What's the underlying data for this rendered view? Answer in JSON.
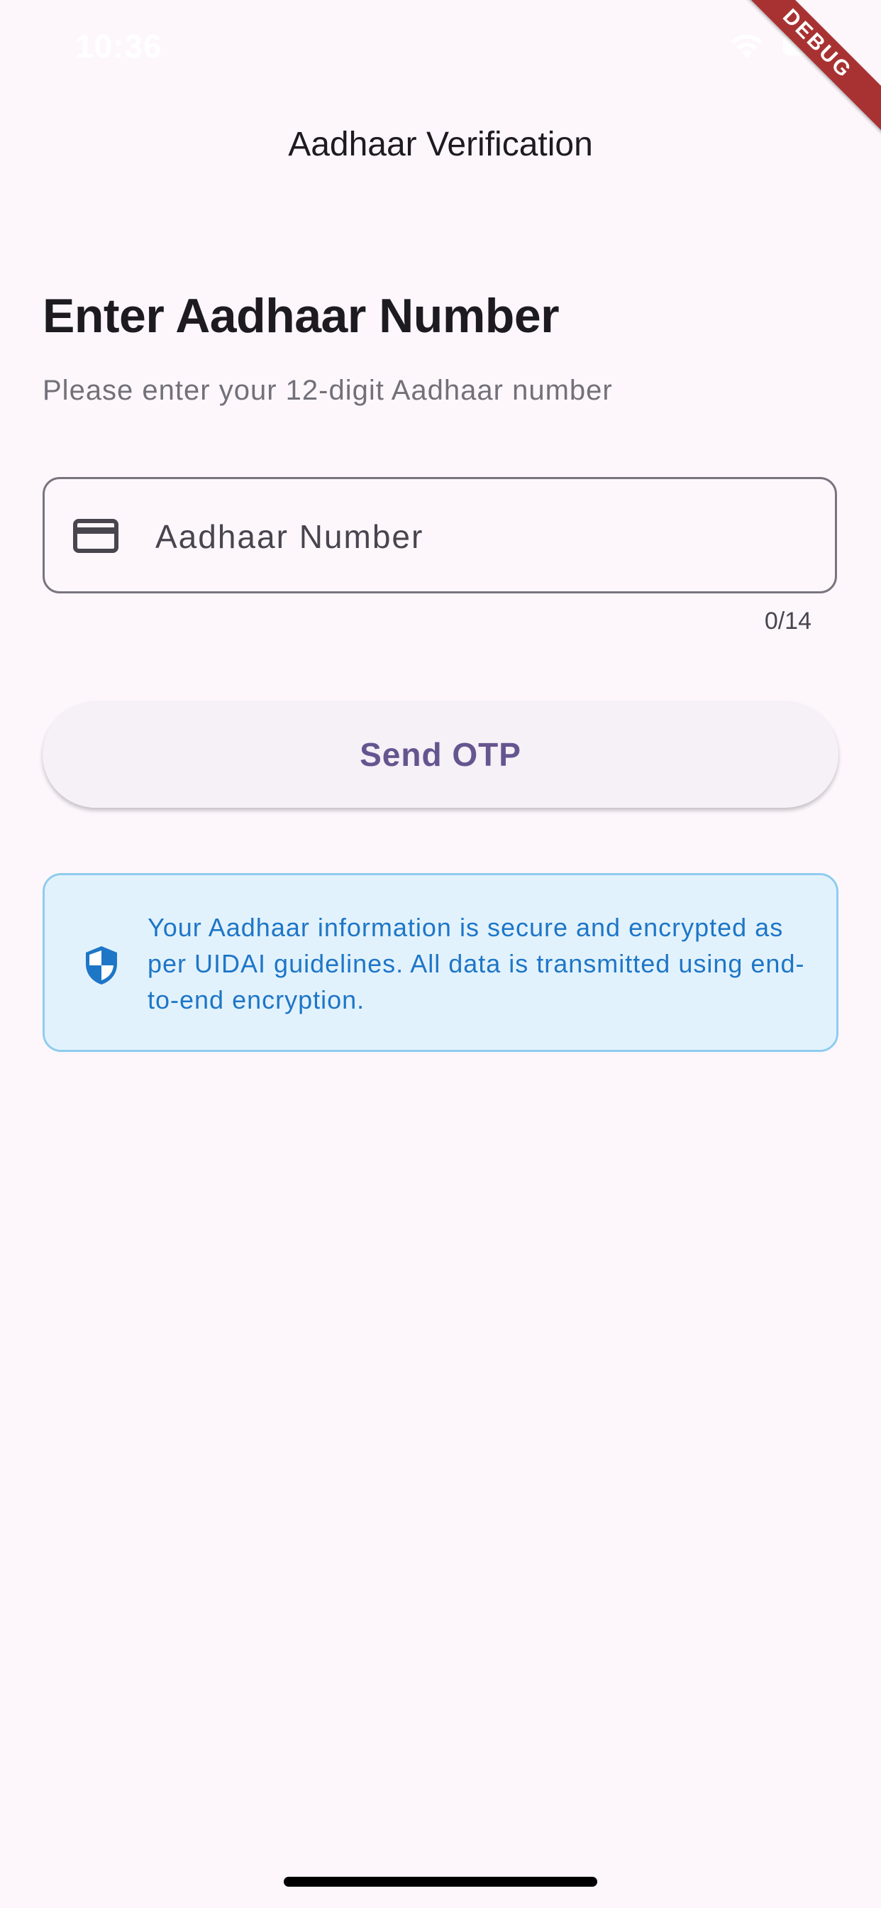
{
  "status_bar": {
    "time": "10:36",
    "icons": [
      "wifi-icon",
      "battery-icon"
    ]
  },
  "debug_banner": "DEBUG",
  "app_bar": {
    "title": "Aadhaar Verification"
  },
  "form": {
    "heading": "Enter Aadhaar Number",
    "subtitle": "Please enter your 12-digit Aadhaar number",
    "aadhaar_input": {
      "icon": "credit-card-icon",
      "placeholder": "Aadhaar Number",
      "value": "",
      "counter": "0/14"
    },
    "send_button_label": "Send OTP"
  },
  "info_notice": {
    "icon": "shield-icon",
    "text": "Your Aadhaar information is secure and encrypted as per UIDAI guidelines. All data is transmitted using end-to-end encryption."
  },
  "colors": {
    "background": "#fdf7fc",
    "primary_text": "#1d1b20",
    "secondary_text": "#727079",
    "button_text": "#65558f",
    "info_background": "#e2f2fc",
    "info_border": "#8fccef",
    "info_text": "#1e76c7",
    "debug_ribbon": "#a83232"
  }
}
